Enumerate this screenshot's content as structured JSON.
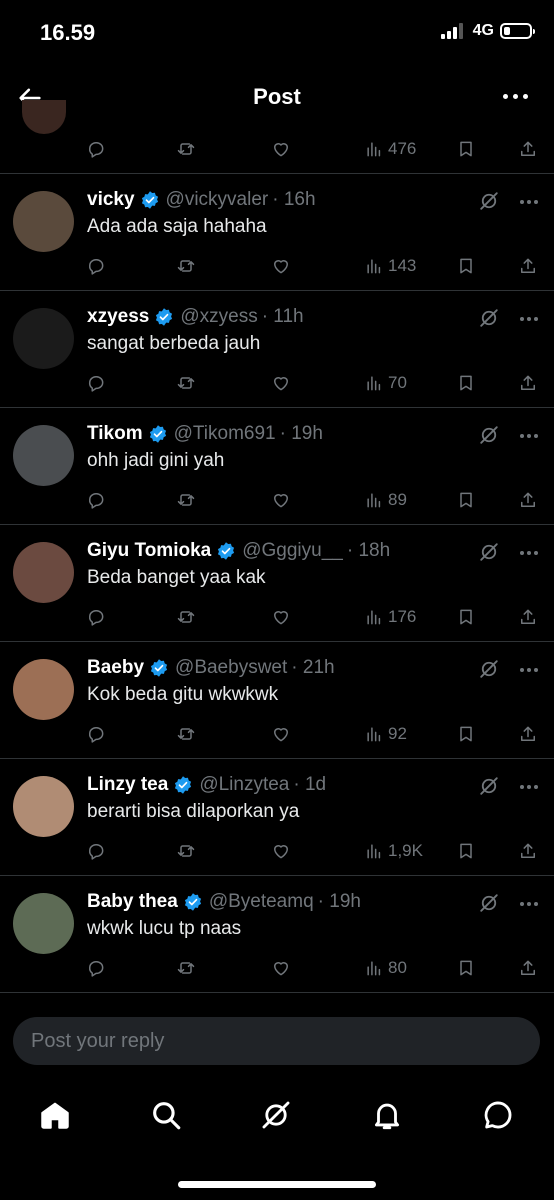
{
  "status_bar": {
    "time": "16.59",
    "network": "4G",
    "battery_level": 0.25
  },
  "header": {
    "title": "Post"
  },
  "first_reply_actions": {
    "views": "476"
  },
  "replies": [
    {
      "name": "vicky",
      "handle": "@vickyvaler",
      "time": "· 16h",
      "text": "Ada ada saja hahaha",
      "views": "143",
      "avatar_color": "#5a4a3c"
    },
    {
      "name": "xzyess",
      "handle": "@xzyess",
      "time": "· 11h",
      "text": "sangat berbeda jauh",
      "views": "70",
      "avatar_color": "#1b1b1b"
    },
    {
      "name": "Tikom",
      "handle": "@Tikom691",
      "time": "· 19h",
      "text": "ohh jadi gini yah",
      "views": "89",
      "avatar_color": "#4a4d50"
    },
    {
      "name": "Giyu Tomioka",
      "handle": "@Gggiyu__",
      "time": "· 18h",
      "text": "Beda banget yaa kak",
      "views": "176",
      "avatar_color": "#6b4a40"
    },
    {
      "name": "Baeby",
      "handle": "@Baebyswet",
      "time": "· 21h",
      "text": "Kok beda gitu wkwkwk",
      "views": "92",
      "avatar_color": "#9c6f55"
    },
    {
      "name": "Linzy tea",
      "handle": "@Linzytea",
      "time": "· 1d",
      "text": "berarti bisa dilaporkan ya",
      "views": "1,9K",
      "avatar_color": "#b08c74"
    },
    {
      "name": "Baby thea",
      "handle": "@Byeteamq",
      "time": "· 19h",
      "text": "wkwk lucu tp naas",
      "views": "80",
      "avatar_color": "#5d6b55"
    }
  ],
  "reply_bar": {
    "placeholder": "Post your reply"
  },
  "colors": {
    "background": "#000000",
    "verified": "#1d9bf0",
    "muted": "#71767b",
    "divider": "#2f3336",
    "input_bg": "#202327"
  },
  "nav_icons": [
    "home-icon",
    "search-icon",
    "grok-icon",
    "notifications-icon",
    "messages-icon"
  ]
}
